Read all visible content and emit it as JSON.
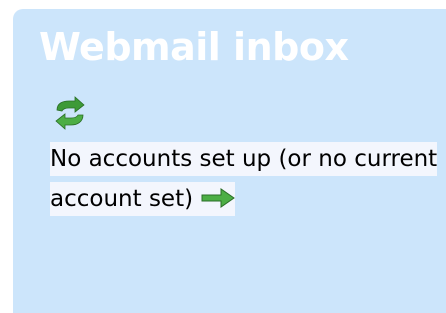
{
  "widget": {
    "title": "Webmail inbox",
    "refresh_icon": "refresh-icon",
    "message": "No accounts set up (or no current account set)",
    "go_icon": "right-arrow-icon"
  },
  "colors": {
    "panel_background": "#cce5fb",
    "title_text": "#ffffff",
    "message_highlight": "#f3f6fd",
    "icon_green": "#3d9a37"
  }
}
